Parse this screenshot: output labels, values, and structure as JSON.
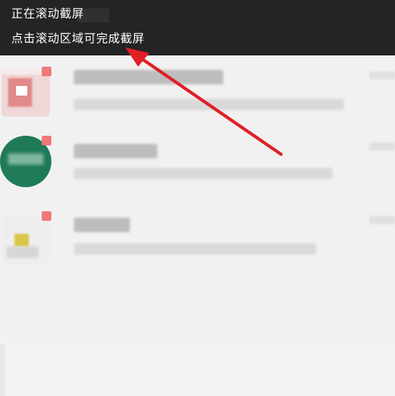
{
  "scroll_screenshot_banner": {
    "line1": "正在滚动截屏",
    "line2": "点击滚动区域可完成截屏"
  },
  "colors": {
    "banner_bg": "#242424",
    "arrow": "#e01f26",
    "badge": "#f07878"
  },
  "conversation_list": {
    "note": "",
    "items": [
      {
        "avatar": "red-white-mosaic",
        "blurred": true
      },
      {
        "avatar": "green-circle",
        "blurred": true
      },
      {
        "avatar": "yellow-gray-mosaic",
        "blurred": true
      }
    ]
  }
}
